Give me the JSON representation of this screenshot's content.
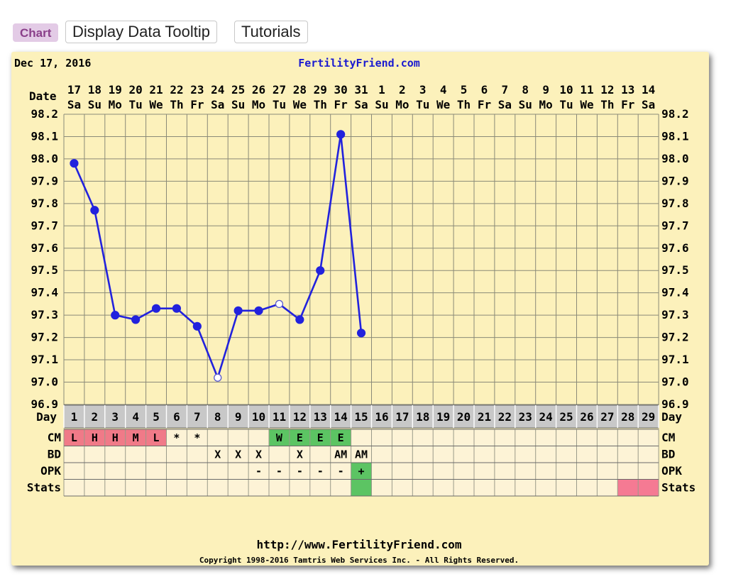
{
  "tabs": [
    "Chart",
    "Display Data Tooltip",
    "Tutorials"
  ],
  "header": {
    "date": "Dec 17, 2016",
    "site": "FertilityFriend.com"
  },
  "footer": {
    "url": "http://www.FertilityFriend.com",
    "copyright": "Copyright 1998-2016 Tamtris Web Services Inc. - All Rights Reserved."
  },
  "colors": {
    "background": "#fcf1bb",
    "grid": "#8a8a78",
    "line": "#2222dd",
    "site_link": "#1a1ad0",
    "cm_fertile_low": "#f07a88",
    "cm_egg_white": "#5cc463",
    "stats_pink": "#f57a93",
    "day_row": "#c8c8c8"
  },
  "chart_data": {
    "type": "line",
    "y_axis_label": "Date",
    "day_row_label": "Day",
    "dates": [
      "17",
      "18",
      "19",
      "20",
      "21",
      "22",
      "23",
      "24",
      "25",
      "26",
      "27",
      "28",
      "29",
      "30",
      "31",
      "1",
      "2",
      "3",
      "4",
      "5",
      "6",
      "7",
      "8",
      "9",
      "10",
      "11",
      "12",
      "13",
      "14"
    ],
    "weekdays": [
      "Sa",
      "Su",
      "Mo",
      "Tu",
      "We",
      "Th",
      "Fr",
      "Sa",
      "Su",
      "Mo",
      "Tu",
      "We",
      "Th",
      "Fr",
      "Sa",
      "Su",
      "Mo",
      "Tu",
      "We",
      "Th",
      "Fr",
      "Sa",
      "Su",
      "Mo",
      "Tu",
      "We",
      "Th",
      "Fr",
      "Sa"
    ],
    "cycle_days": [
      "1",
      "2",
      "3",
      "4",
      "5",
      "6",
      "7",
      "8",
      "9",
      "10",
      "11",
      "12",
      "13",
      "14",
      "15",
      "16",
      "17",
      "18",
      "19",
      "20",
      "21",
      "22",
      "23",
      "24",
      "25",
      "26",
      "27",
      "28",
      "29"
    ],
    "ylim": [
      96.9,
      98.2
    ],
    "y_ticks": [
      "98.2",
      "98.1",
      "98.0",
      "97.9",
      "97.8",
      "97.7",
      "97.6",
      "97.5",
      "97.4",
      "97.3",
      "97.2",
      "97.1",
      "97.0",
      "96.9"
    ],
    "temperatures": [
      {
        "day": 1,
        "value": 97.98,
        "marker": "filled"
      },
      {
        "day": 2,
        "value": 97.77,
        "marker": "filled"
      },
      {
        "day": 3,
        "value": 97.3,
        "marker": "filled"
      },
      {
        "day": 4,
        "value": 97.28,
        "marker": "filled"
      },
      {
        "day": 5,
        "value": 97.33,
        "marker": "filled"
      },
      {
        "day": 6,
        "value": 97.33,
        "marker": "filled"
      },
      {
        "day": 7,
        "value": 97.25,
        "marker": "filled"
      },
      {
        "day": 8,
        "value": 97.02,
        "marker": "open"
      },
      {
        "day": 9,
        "value": 97.32,
        "marker": "filled"
      },
      {
        "day": 10,
        "value": 97.32,
        "marker": "filled"
      },
      {
        "day": 11,
        "value": 97.35,
        "marker": "open"
      },
      {
        "day": 12,
        "value": 97.28,
        "marker": "filled"
      },
      {
        "day": 13,
        "value": 97.5,
        "marker": "filled"
      },
      {
        "day": 14,
        "value": 98.11,
        "marker": "filled"
      },
      {
        "day": 15,
        "value": 97.22,
        "marker": "filled"
      }
    ],
    "rows": [
      {
        "label": "CM",
        "cells": [
          {
            "day": 1,
            "text": "L",
            "fill": "#f07a88"
          },
          {
            "day": 2,
            "text": "H",
            "fill": "#f07a88"
          },
          {
            "day": 3,
            "text": "H",
            "fill": "#f07a88"
          },
          {
            "day": 4,
            "text": "M",
            "fill": "#f07a88"
          },
          {
            "day": 5,
            "text": "L",
            "fill": "#f07a88"
          },
          {
            "day": 6,
            "text": "*",
            "fill": ""
          },
          {
            "day": 7,
            "text": "*",
            "fill": ""
          },
          {
            "day": 11,
            "text": "W",
            "fill": "#5cc463"
          },
          {
            "day": 12,
            "text": "E",
            "fill": "#5cc463"
          },
          {
            "day": 13,
            "text": "E",
            "fill": "#5cc463"
          },
          {
            "day": 14,
            "text": "E",
            "fill": "#5cc463"
          }
        ]
      },
      {
        "label": "BD",
        "cells": [
          {
            "day": 8,
            "text": "X",
            "fill": ""
          },
          {
            "day": 9,
            "text": "X",
            "fill": ""
          },
          {
            "day": 10,
            "text": "X",
            "fill": ""
          },
          {
            "day": 12,
            "text": "X",
            "fill": ""
          },
          {
            "day": 14,
            "text": "AM",
            "fill": ""
          },
          {
            "day": 15,
            "text": "AM",
            "fill": ""
          }
        ]
      },
      {
        "label": "OPK",
        "cells": [
          {
            "day": 10,
            "text": "-",
            "fill": ""
          },
          {
            "day": 11,
            "text": "-",
            "fill": ""
          },
          {
            "day": 12,
            "text": "-",
            "fill": ""
          },
          {
            "day": 13,
            "text": "-",
            "fill": ""
          },
          {
            "day": 14,
            "text": "-",
            "fill": ""
          },
          {
            "day": 15,
            "text": "+",
            "fill": "#5cc463"
          }
        ]
      },
      {
        "label": "Stats",
        "cells": [
          {
            "day": 15,
            "text": "",
            "fill": "#5cc463"
          },
          {
            "day": 28,
            "text": "",
            "fill": "#f57a93"
          },
          {
            "day": 29,
            "text": "",
            "fill": "#f57a93"
          }
        ]
      }
    ]
  }
}
